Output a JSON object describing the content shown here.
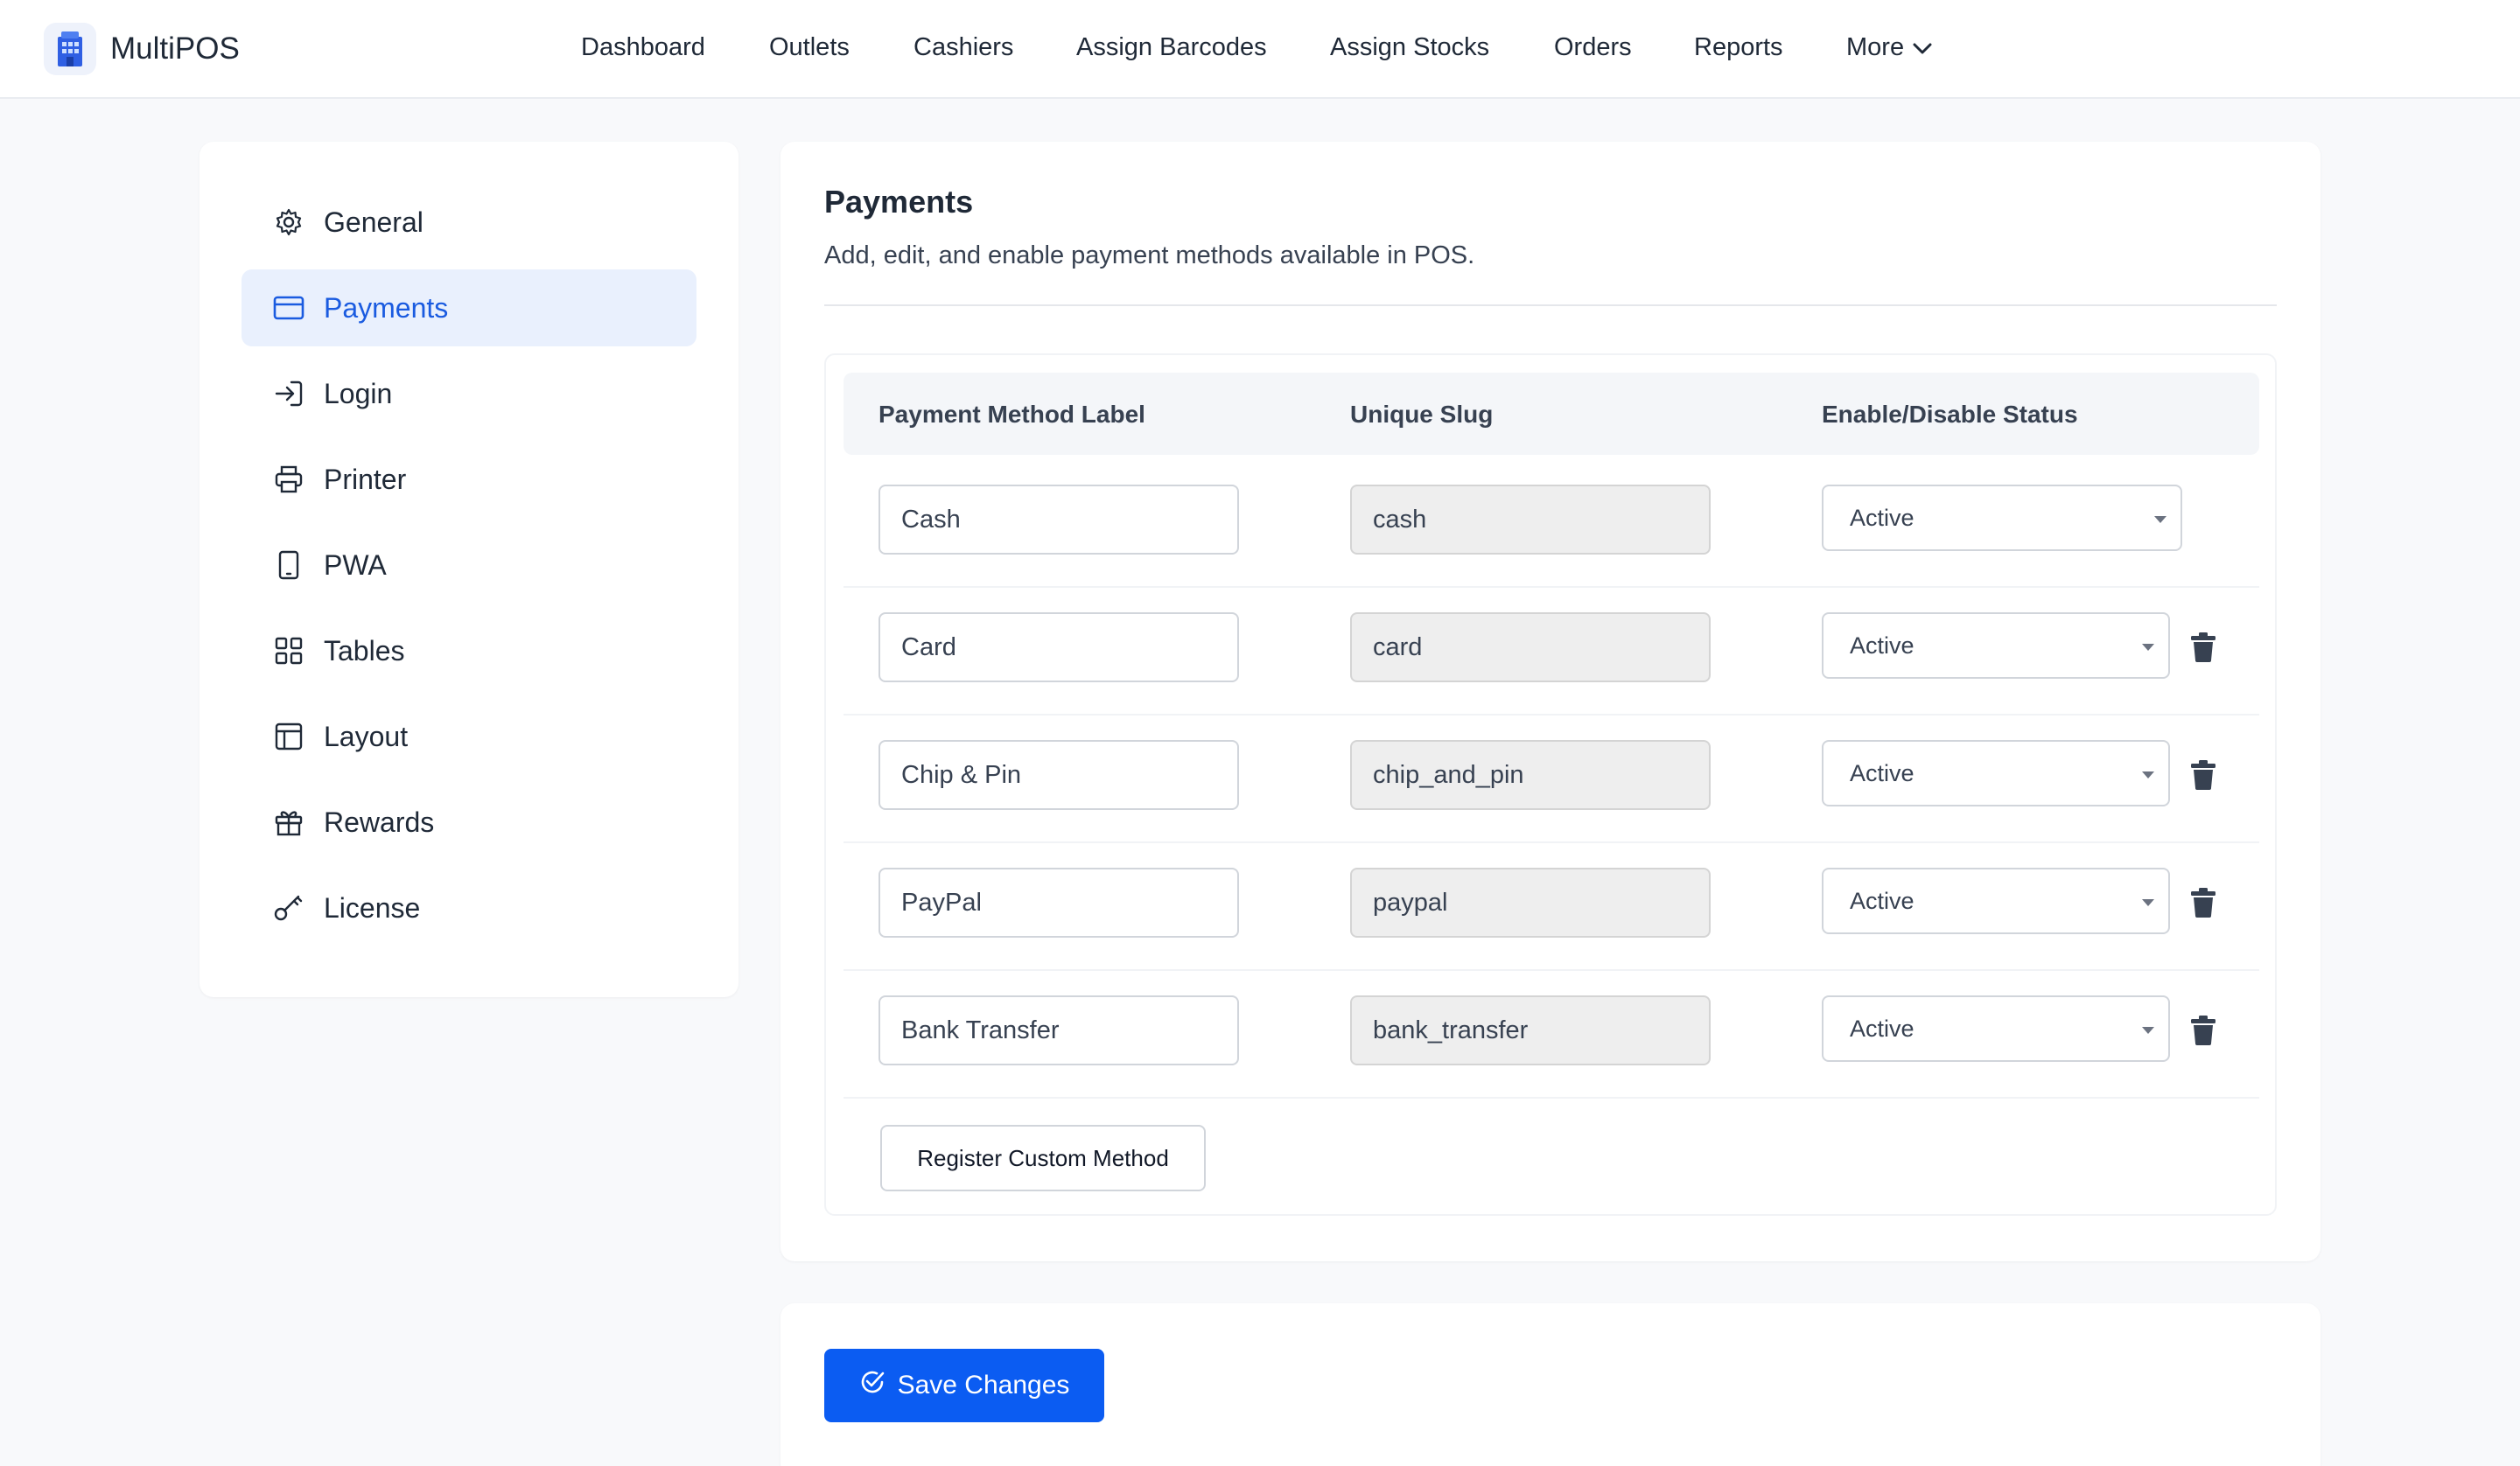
{
  "app": {
    "name": "MultiPOS",
    "logo_icon": "store-building-icon",
    "accent": "#0b5cf2"
  },
  "nav": {
    "items": [
      {
        "label": "Dashboard"
      },
      {
        "label": "Outlets"
      },
      {
        "label": "Cashiers"
      },
      {
        "label": "Assign Barcodes"
      },
      {
        "label": "Assign Stocks"
      },
      {
        "label": "Orders"
      },
      {
        "label": "Reports"
      },
      {
        "label": "More"
      }
    ]
  },
  "sidebar": {
    "active": "Payments",
    "items": [
      {
        "label": "General",
        "icon": "gear-icon"
      },
      {
        "label": "Payments",
        "icon": "credit-card-icon"
      },
      {
        "label": "Login",
        "icon": "login-arrow-icon"
      },
      {
        "label": "Printer",
        "icon": "printer-icon"
      },
      {
        "label": "PWA",
        "icon": "mobile-device-icon"
      },
      {
        "label": "Tables",
        "icon": "grid-icon"
      },
      {
        "label": "Layout",
        "icon": "layout-icon"
      },
      {
        "label": "Rewards",
        "icon": "gift-icon"
      },
      {
        "label": "License",
        "icon": "key-icon"
      }
    ]
  },
  "main": {
    "title": "Payments",
    "subtitle": "Add, edit, and enable payment methods available in POS.",
    "columns": [
      "Payment Method Label",
      "Unique Slug",
      "Enable/Disable Status"
    ],
    "rows": [
      {
        "label": "Cash",
        "slug": "cash",
        "status": "Active",
        "deletable": false
      },
      {
        "label": "Card",
        "slug": "card",
        "status": "Active",
        "deletable": true
      },
      {
        "label": "Chip & Pin",
        "slug": "chip_and_pin",
        "status": "Active",
        "deletable": true
      },
      {
        "label": "PayPal",
        "slug": "paypal",
        "status": "Active",
        "deletable": true
      },
      {
        "label": "Bank Transfer",
        "slug": "bank_transfer",
        "status": "Active",
        "deletable": true
      }
    ],
    "register_label": "Register Custom Method"
  },
  "footer": {
    "save_label": "Save Changes"
  }
}
